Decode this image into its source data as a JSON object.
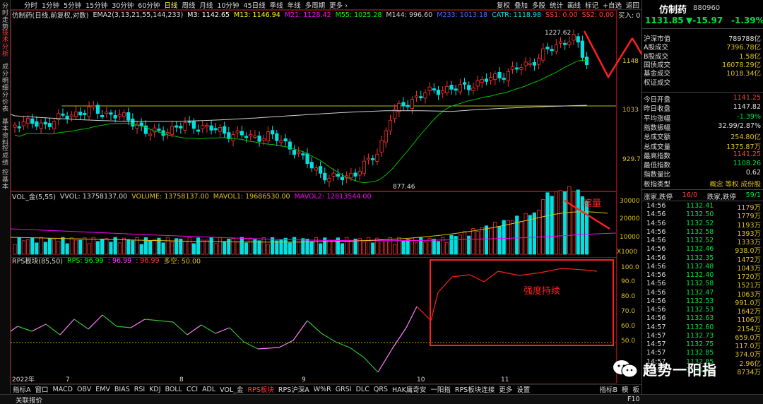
{
  "left_tabs": [
    {
      "label": "分时走势",
      "on": false
    },
    {
      "label": "技术分析",
      "on": true
    },
    {
      "label": "成分明细",
      "on": false
    },
    {
      "label": "分价表",
      "on": false
    },
    {
      "label": "基本资料",
      "on": false
    },
    {
      "label": "控成绩",
      "on": false
    },
    {
      "label": "控基本",
      "on": false
    }
  ],
  "periods": [
    "分时",
    "1分钟",
    "5分钟",
    "15分钟",
    "30分钟",
    "60分钟",
    "日线",
    "周线",
    "月线",
    "10分钟",
    "45日线",
    "季线",
    "年线",
    "多周期",
    "更多 ›"
  ],
  "active_period": "日线",
  "toolbar_right": [
    "复权",
    "叠加",
    "多股",
    "统计",
    "画线",
    "标记",
    "+自选",
    "返回"
  ],
  "main_header": {
    "name": "仿制药(日线,前复权,对数)",
    "ema_label": "EMA2(3,13,21,55,144,233)",
    "m3": "M3: 1142.65",
    "m13": "M13: 1146.94",
    "m21": "M21: 1128.42",
    "m55": "M55: 1025.28",
    "m144": "M144: 996.60",
    "m233": "M233: 1013.18",
    "catr": "CATR: 1118.98",
    "ss1": "SS1: 0.00",
    "ss2": "SS2: 0.00",
    "buy": "买入: 0"
  },
  "price_ticks": [
    "1148",
    "1033",
    "929.7"
  ],
  "price_labels": {
    "high": "1227.62",
    "low": "877.46"
  },
  "vol_header": {
    "name": "VOL_金(5,55)",
    "vvol": "VVOL: 13758137.00",
    "volume": "VOLUME: 13758137.00",
    "mavol1": "MAVOL1: 19686530.00",
    "mavol2": "MAVOL2: 12813544.00"
  },
  "vol_ticks": [
    "30000",
    "20000",
    "10000"
  ],
  "vol_unit": "X1000",
  "rps_header": {
    "name": "RPS板块(85,50)",
    "rps": "RPS: 96.99",
    "v2": ": 96.99",
    "v3": ": 96.99",
    "duokong": "多空: 50.00"
  },
  "rps_ticks": [
    "100.0",
    "90.0",
    "80.0",
    "70.0",
    "60.0",
    "50.0"
  ],
  "annotations": {
    "suoliang": "缩量",
    "qiangdu": "强度持续"
  },
  "x_axis": [
    "2022年",
    "7",
    "8",
    "9",
    "10",
    "11"
  ],
  "bottom_tabs": [
    "指标A",
    "窗口",
    "MACD",
    "OBV",
    "EMV",
    "BIAS",
    "RSI",
    "KDJ",
    "BOLL",
    "CCI",
    "ADL",
    "VOL_金",
    "RPS板块",
    "RPS沪深A",
    "W%R",
    "GRSI",
    "DLC",
    "QRS",
    "HAK庸奇安",
    "一阳指",
    "RPS板块连接",
    "更多",
    "设置"
  ],
  "active_bottom": "RPS板块",
  "bottom_right": [
    "指标B",
    "模",
    "板"
  ],
  "status": {
    "left": "关联报价",
    "right": "F10"
  },
  "right_panel": {
    "title": "仿制药",
    "code": "880960",
    "price": "1131.85",
    "change": "▼-15.97",
    "pct": "-1.39%",
    "stats": [
      {
        "k": "沪深市值",
        "v": "789788亿",
        "c": "#e0e0e0"
      },
      {
        "k": "A股成交",
        "v": "7396.78亿",
        "c": "#e0c020"
      },
      {
        "k": "B股成交",
        "v": "1.58亿",
        "c": "#e0c020"
      },
      {
        "k": "国债成交",
        "v": "16078.29亿",
        "c": "#e0c020"
      },
      {
        "k": "基金成交",
        "v": "1018.34亿",
        "c": "#e0c020"
      },
      {
        "k": "权证成交",
        "v": "",
        "c": "#e0c020"
      }
    ],
    "stats2": [
      {
        "k": "今日开盘",
        "v": "1141.25",
        "c": "#ff4040"
      },
      {
        "k": "昨日收盘",
        "v": "1147.82",
        "c": "#e0e0e0"
      },
      {
        "k": "平均涨幅",
        "v": "-1.39%",
        "c": "#00e040"
      },
      {
        "k": "指数振幅",
        "v": "32.99/2.87%",
        "c": "#e0e0e0"
      },
      {
        "k": "总成交额",
        "v": "254.80亿",
        "c": "#e0c020"
      },
      {
        "k": "总成交量",
        "v": "1375.87万",
        "c": "#e0c020"
      },
      {
        "k": "最高指数",
        "v": "1141.25",
        "c": "#ff4040"
      },
      {
        "k": "最低指数",
        "v": "1108.26",
        "c": "#00e040"
      },
      {
        "k": "指数量比",
        "v": "0.62",
        "c": "#e0e0e0"
      },
      {
        "k": "板指类型",
        "v": "概念 等权 成份股",
        "c": "#e0c020"
      }
    ],
    "updown": {
      "a": "涨家,跌停",
      "b": "16/0",
      "c": "跌家,跌停",
      "d": "59/1"
    },
    "ticks": [
      {
        "t": "14:56",
        "p": "1132.41",
        "v": "1179万"
      },
      {
        "t": "14:56",
        "p": "1132.50",
        "v": "1779万"
      },
      {
        "t": "14:56",
        "p": "1132.52",
        "v": "1193万"
      },
      {
        "t": "14:56",
        "p": "1132.58",
        "v": "1393万"
      },
      {
        "t": "14:56",
        "p": "1132.52",
        "v": "1333万"
      },
      {
        "t": "14:56",
        "p": "1132.46",
        "v": "938.0万"
      },
      {
        "t": "14:56",
        "p": "1132.35",
        "v": "1472万"
      },
      {
        "t": "14:56",
        "p": "1132.48",
        "v": "1043万"
      },
      {
        "t": "14:56",
        "p": "1132.40",
        "v": "1720万"
      },
      {
        "t": "14:56",
        "p": "1132.58",
        "v": "1521万"
      },
      {
        "t": "14:56",
        "p": "1132.47",
        "v": "1063万"
      },
      {
        "t": "14:56",
        "p": "1132.53",
        "v": "991.0万"
      },
      {
        "t": "14:56",
        "p": "1132.53",
        "v": "1642万"
      },
      {
        "t": "14:56",
        "p": "1132.63",
        "v": "1106万"
      },
      {
        "t": "14:57",
        "p": "1132.60",
        "v": "2154万"
      },
      {
        "t": "14:57",
        "p": "1132.73",
        "v": "659.0万"
      },
      {
        "t": "14:57",
        "p": "1132.75",
        "v": "117.0万"
      },
      {
        "t": "14:57",
        "p": "1132.85",
        "v": "374.0万"
      },
      {
        "t": "14:57",
        "p": "1132.85",
        "v": "2.96亿"
      },
      {
        "t": "15:00",
        "p": "1131.85",
        "v": "8734万"
      }
    ]
  },
  "watermark": "趋势一阳指"
}
